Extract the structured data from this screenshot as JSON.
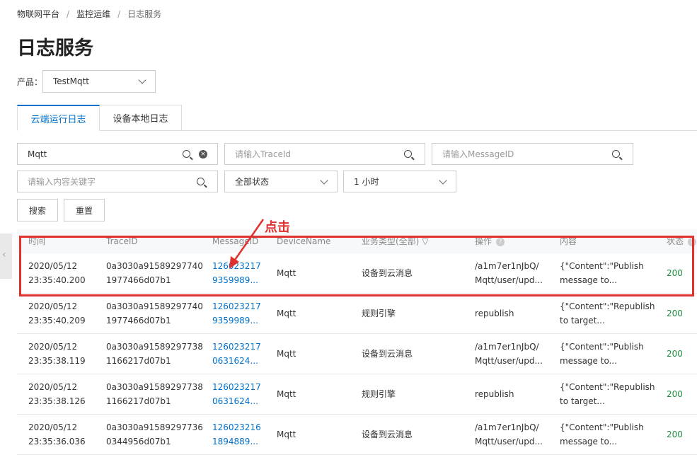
{
  "breadcrumb": [
    "物联网平台",
    "监控运维",
    "日志服务"
  ],
  "page_title": "日志服务",
  "product": {
    "label": "产品：",
    "value": "TestMqtt"
  },
  "tabs": [
    {
      "label": "云端运行日志",
      "active": true
    },
    {
      "label": "设备本地日志",
      "active": false
    }
  ],
  "filters": {
    "device_value": "Mqtt",
    "traceid_placeholder": "请输入TraceId",
    "messageid_placeholder": "请输入MessageID",
    "keyword_placeholder": "请输入内容关键字",
    "status": "全部状态",
    "time_range": "1 小时",
    "search_label": "搜索",
    "reset_label": "重置"
  },
  "table": {
    "columns": [
      "时间",
      "TraceID",
      "MessageID",
      "DeviceName",
      "业务类型(全部)",
      "操作",
      "内容",
      "状态"
    ],
    "rows": [
      {
        "time1": "2020/05/12",
        "time2": "23:35:40.200",
        "trace1": "0a3030a91589297740",
        "trace2": "1977466d07b1",
        "msg1": "126023217",
        "msg2": "9359989...",
        "device": "Mqtt",
        "type": "设备到云消息",
        "op1": "/a1m7er1nJbQ/",
        "op2": "Mqtt/user/upd...",
        "content1": "{\"Content\":\"Publish",
        "content2": "message to...",
        "status": "200"
      },
      {
        "time1": "2020/05/12",
        "time2": "23:35:40.209",
        "trace1": "0a3030a91589297740",
        "trace2": "1977466d07b1",
        "msg1": "126023217",
        "msg2": "9359989...",
        "device": "Mqtt",
        "type": "规则引擎",
        "op1": "republish",
        "op2": "",
        "content1": "{\"Content\":\"Republish",
        "content2": "to target...",
        "status": "200"
      },
      {
        "time1": "2020/05/12",
        "time2": "23:35:38.119",
        "trace1": "0a3030a91589297738",
        "trace2": "1166217d07b1",
        "msg1": "126023217",
        "msg2": "0631624...",
        "device": "Mqtt",
        "type": "设备到云消息",
        "op1": "/a1m7er1nJbQ/",
        "op2": "Mqtt/user/upd...",
        "content1": "{\"Content\":\"Publish",
        "content2": "message to...",
        "status": "200"
      },
      {
        "time1": "2020/05/12",
        "time2": "23:35:38.126",
        "trace1": "0a3030a91589297738",
        "trace2": "1166217d07b1",
        "msg1": "126023217",
        "msg2": "0631624...",
        "device": "Mqtt",
        "type": "规则引擎",
        "op1": "republish",
        "op2": "",
        "content1": "{\"Content\":\"Republish",
        "content2": "to target...",
        "status": "200"
      },
      {
        "time1": "2020/05/12",
        "time2": "23:35:36.036",
        "trace1": "0a3030a91589297736",
        "trace2": "0344956d07b1",
        "msg1": "126023216",
        "msg2": "1894889...",
        "device": "Mqtt",
        "type": "设备到云消息",
        "op1": "/a1m7er1nJbQ/",
        "op2": "Mqtt/user/upd...",
        "content1": "{\"Content\":\"Publish",
        "content2": "message to...",
        "status": "200"
      }
    ]
  },
  "annotation": {
    "label": "点击",
    "color": "#e0302f"
  },
  "colors": {
    "accent": "#0070cc",
    "success": "#1e8e3e",
    "highlight": "#e0302f"
  }
}
